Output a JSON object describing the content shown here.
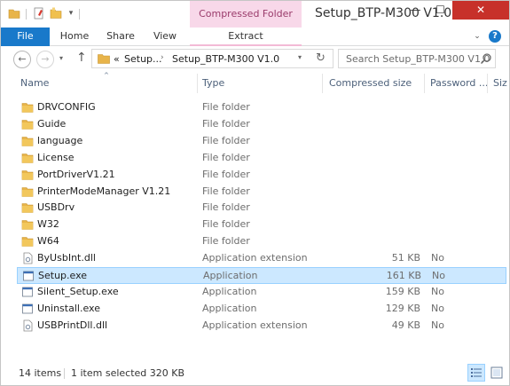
{
  "window": {
    "title": "Setup_BTP-M300 V1.0",
    "context_group": "Compressed Folder Tools",
    "minimize": "—",
    "maximize": "☐",
    "close": "✕"
  },
  "quick_access": {
    "dropdown": "▾"
  },
  "ribbon": {
    "tabs": [
      {
        "label": "File"
      },
      {
        "label": "Home"
      },
      {
        "label": "Share"
      },
      {
        "label": "View"
      },
      {
        "label": "Extract"
      }
    ],
    "expand": "⌄",
    "help": "?"
  },
  "navigation": {
    "back": "←",
    "forward": "→",
    "recent": "▾",
    "up": "↑",
    "address": {
      "overflow": "«",
      "crumbs": [
        "Setup...",
        "Setup_BTP-M300 V1.0"
      ],
      "separator": "›",
      "dropdown": "▾",
      "refresh": "↻"
    },
    "search": {
      "placeholder": "Search Setup_BTP-M300 V1.0"
    }
  },
  "columns": {
    "name": "Name",
    "type": "Type",
    "compressed_size": "Compressed size",
    "password": "Password ...",
    "size": "Siz",
    "sort_indicator": "^"
  },
  "files": [
    {
      "name": "DRVCONFIG",
      "type": "File folder",
      "size": "",
      "password": "",
      "icon": "folder-icon"
    },
    {
      "name": "Guide",
      "type": "File folder",
      "size": "",
      "password": "",
      "icon": "folder-icon"
    },
    {
      "name": "language",
      "type": "File folder",
      "size": "",
      "password": "",
      "icon": "folder-icon"
    },
    {
      "name": "License",
      "type": "File folder",
      "size": "",
      "password": "",
      "icon": "folder-icon"
    },
    {
      "name": "PortDriverV1.21",
      "type": "File folder",
      "size": "",
      "password": "",
      "icon": "folder-icon"
    },
    {
      "name": "PrinterModeManager V1.21",
      "type": "File folder",
      "size": "",
      "password": "",
      "icon": "folder-icon"
    },
    {
      "name": "USBDrv",
      "type": "File folder",
      "size": "",
      "password": "",
      "icon": "folder-icon"
    },
    {
      "name": "W32",
      "type": "File folder",
      "size": "",
      "password": "",
      "icon": "folder-icon"
    },
    {
      "name": "W64",
      "type": "File folder",
      "size": "",
      "password": "",
      "icon": "folder-icon"
    },
    {
      "name": "ByUsbInt.dll",
      "type": "Application extension",
      "size": "51 KB",
      "password": "No",
      "icon": "dll-file-icon"
    },
    {
      "name": "Setup.exe",
      "type": "Application",
      "size": "161 KB",
      "password": "No",
      "icon": "exe-file-icon",
      "selected": true
    },
    {
      "name": "Silent_Setup.exe",
      "type": "Application",
      "size": "159 KB",
      "password": "No",
      "icon": "exe-file-icon"
    },
    {
      "name": "Uninstall.exe",
      "type": "Application",
      "size": "129 KB",
      "password": "No",
      "icon": "exe-file-icon"
    },
    {
      "name": "USBPrintDll.dll",
      "type": "Application extension",
      "size": "49 KB",
      "password": "No",
      "icon": "dll-file-icon"
    }
  ],
  "status": {
    "item_count": "14 items",
    "selection": "1 item selected  320 KB"
  },
  "colors": {
    "file_tab": "#1979ca",
    "context_tab": "#f8d8e9",
    "close_button": "#c7312a",
    "selection": "#cce8ff",
    "folder": "#e8b44a"
  }
}
